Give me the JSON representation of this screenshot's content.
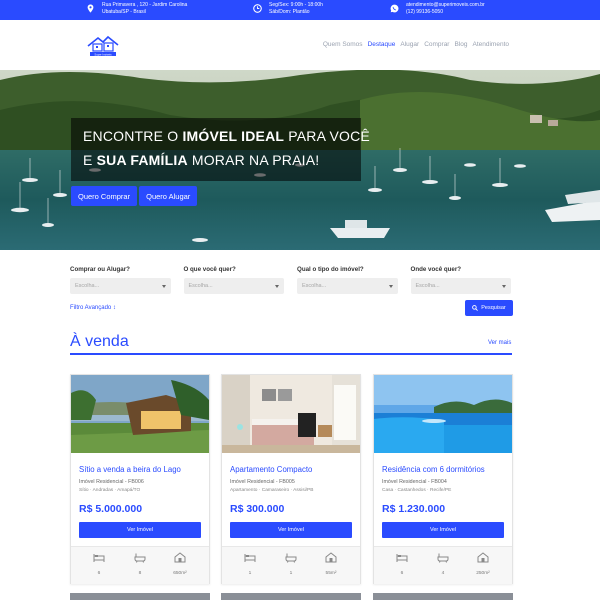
{
  "topbar": {
    "address": {
      "icon": "map-pin-icon",
      "line1": "Rua Primavera , 120 - Jardim Carolina",
      "line2": "Ubatuba/SP - Brasil"
    },
    "hours": {
      "icon": "clock-icon",
      "line1": "Seg/Sex: 9:00h - 18:00h",
      "line2": "Sáb/Dom: Plantão"
    },
    "contact": {
      "icon": "whatsapp-icon",
      "line1": "atendimento@superimoveis.com.br",
      "line2": "(12) 99136-5050"
    }
  },
  "brand": {
    "logo_icon": "house-logo-icon",
    "logo_text": "Super Imóveis"
  },
  "nav": {
    "items": [
      {
        "label": "Quem Somos",
        "active": false
      },
      {
        "label": "Destaque",
        "active": true
      },
      {
        "label": "Alugar",
        "active": false
      },
      {
        "label": "Comprar",
        "active": false
      },
      {
        "label": "Blog",
        "active": false
      },
      {
        "label": "Atendimento",
        "active": false
      }
    ]
  },
  "hero": {
    "line1_a": "ENCONTRE O ",
    "line1_b": "IMÓVEL IDEAL",
    "line1_c": " PARA VOCÊ",
    "line2_a": "E ",
    "line2_b": "SUA FAMÍLIA",
    "line2_c": " MORAR NA PRAIA!",
    "buy_button": "Quero Comprar",
    "rent_button": "Quero Alugar"
  },
  "filters": {
    "fields": [
      {
        "label": "Comprar ou Alugar?",
        "value": "Escolha..."
      },
      {
        "label": "O que você quer?",
        "value": "Escolha..."
      },
      {
        "label": "Qual o tipo do imóvel?",
        "value": "Escolha..."
      },
      {
        "label": "Onde você quer?",
        "value": "Escolha..."
      }
    ],
    "advanced_link": "Filtro Avançado ↕",
    "search_button": "Pesquisar"
  },
  "section": {
    "title": "À venda",
    "see_more": "Ver mais"
  },
  "listings": [
    {
      "title": "Sítio a venda a beira do Lago",
      "subtitle": "Imóvel Residencial - FB006",
      "location": "Sítio · Andradas · Amapá/TO",
      "price": "R$ 5.000.000",
      "button": "Ver Imóvel",
      "beds": "6",
      "baths": "8",
      "area": "650m²"
    },
    {
      "title": "Apartamento Compacto",
      "subtitle": "Imóvel Residencial - FB005",
      "location": "Apartamento · Camaraseiro · Assisi/PB",
      "price": "R$ 300.000",
      "button": "Ver Imóvel",
      "beds": "1",
      "baths": "1",
      "area": "55m²"
    },
    {
      "title": "Residência com 6 dormitórios",
      "subtitle": "Imóvel Residencial - FB004",
      "location": "Casa · Castanhedos · Recife/PE",
      "price": "R$ 1.230.000",
      "button": "Ver Imóvel",
      "beds": "6",
      "baths": "4",
      "area": "250m²"
    }
  ],
  "colors": {
    "brand_blue": "#2a4bff",
    "dark_overlay": "#000000"
  }
}
